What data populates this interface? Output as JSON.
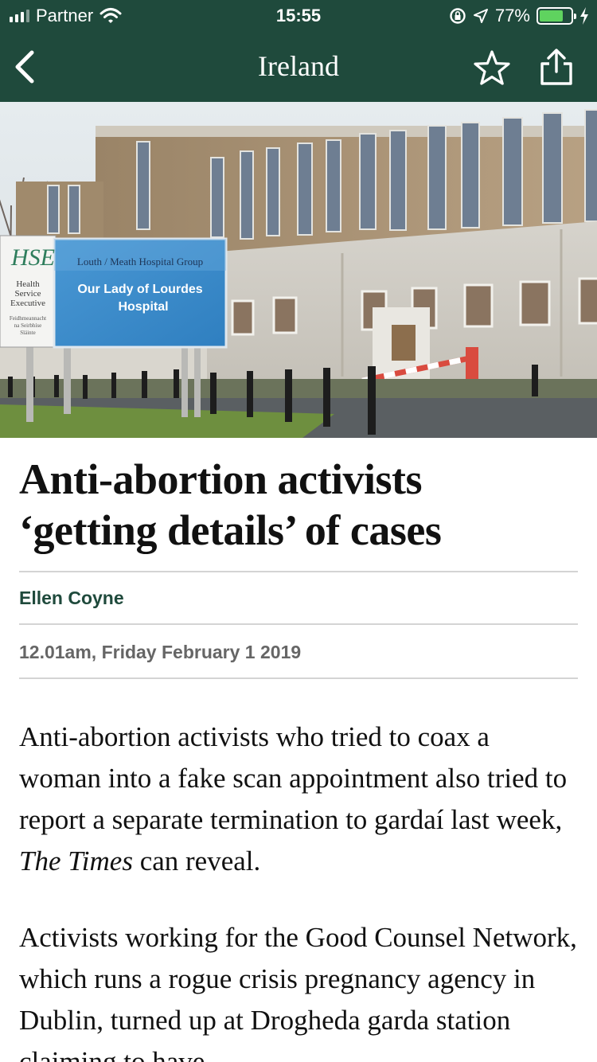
{
  "status_bar": {
    "carrier": "Partner",
    "time": "15:55",
    "battery_percent": "77%",
    "battery_level": 0.77
  },
  "nav": {
    "title": "Ireland",
    "back_icon": "chevron-left-icon",
    "bookmark_icon": "star-icon",
    "share_icon": "share-icon"
  },
  "hero_image": {
    "sign_logo_text": "HSE",
    "sign_org_lines": [
      "Health",
      "Service",
      "Executive"
    ],
    "sign_irish_lines": [
      "Feidhmeannacht",
      "na Seirbhíse",
      "Sláinte"
    ],
    "sign_group": "Louth / Meath Hospital Group",
    "sign_name_line1": "Our Lady of Lourdes",
    "sign_name_line2": "Hospital"
  },
  "article": {
    "headline_line1": "Anti-abortion activists",
    "headline_line2": "‘getting details’ of cases",
    "author": "Ellen Coyne",
    "dateline": "12.01am, Friday February 1 2019",
    "para1_before": "Anti-abortion activists who tried to coax a woman into a fake scan appointment also tried to report a separate termination to gardaí last week, ",
    "para1_italic": "The Times",
    "para1_after": " can reveal.",
    "para2": "Activists working for the Good Counsel Network, which runs a rogue crisis pregnancy agency in Dublin, turned up at Drogheda garda station claiming to have"
  },
  "colors": {
    "brand_green": "#1f4a3c",
    "byline_green": "#1f4a3c",
    "dateline_gray": "#666666",
    "battery_green": "#5fd35f"
  }
}
